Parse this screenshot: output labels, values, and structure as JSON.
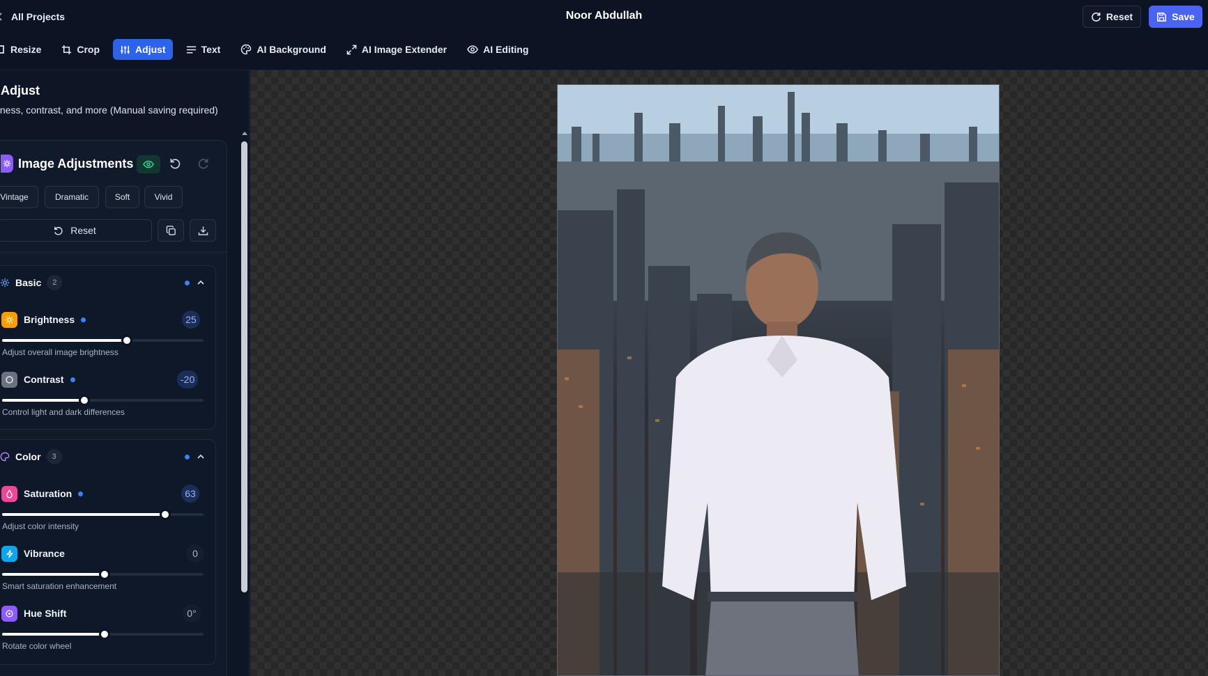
{
  "header": {
    "back_label": "All Projects",
    "project_name": "Noor Abdullah",
    "reset_label": "Reset",
    "save_label": "Save"
  },
  "toolbar": {
    "tools": [
      {
        "label": "Resize",
        "icon": "resize-icon",
        "active": false
      },
      {
        "label": "Crop",
        "icon": "crop-icon",
        "active": false
      },
      {
        "label": "Adjust",
        "icon": "sliders-icon",
        "active": true
      },
      {
        "label": "Text",
        "icon": "text-icon",
        "active": false
      },
      {
        "label": "AI Background",
        "icon": "palette-icon",
        "active": false
      },
      {
        "label": "AI Image Extender",
        "icon": "expand-icon",
        "active": false
      },
      {
        "label": "AI Editing",
        "icon": "eye-icon",
        "active": false
      }
    ]
  },
  "panel": {
    "title": "Adjust",
    "subtitle": "tness, contrast, and more (Manual saving required)",
    "card_title": "Image Adjustments",
    "presets": [
      "Vintage",
      "Dramatic",
      "Soft",
      "Vivid"
    ],
    "reset_label": "Reset"
  },
  "sections": {
    "basic": {
      "label": "Basic",
      "count": "2",
      "controls": {
        "brightness": {
          "label": "Brightness",
          "value": "25",
          "help": "Adjust overall image brightness",
          "level_pct": 62,
          "changed": true
        },
        "contrast": {
          "label": "Contrast",
          "value": "-20",
          "help": "Control light and dark differences",
          "level_pct": 41,
          "changed": true
        }
      }
    },
    "color": {
      "label": "Color",
      "count": "3",
      "controls": {
        "saturation": {
          "label": "Saturation",
          "value": "63",
          "help": "Adjust color intensity",
          "level_pct": 81,
          "changed": true
        },
        "vibrance": {
          "label": "Vibrance",
          "value": "0",
          "help": "Smart saturation enhancement",
          "level_pct": 51,
          "changed": false
        },
        "hue_shift": {
          "label": "Hue Shift",
          "value": "0°",
          "help": "Rotate color wheel",
          "level_pct": 51,
          "changed": false
        }
      }
    }
  },
  "colors": {
    "accent": "#2d63ea",
    "save": "#4b63f2",
    "changed_dot": "#3b82f6",
    "visible_toggle": "#34d399"
  }
}
